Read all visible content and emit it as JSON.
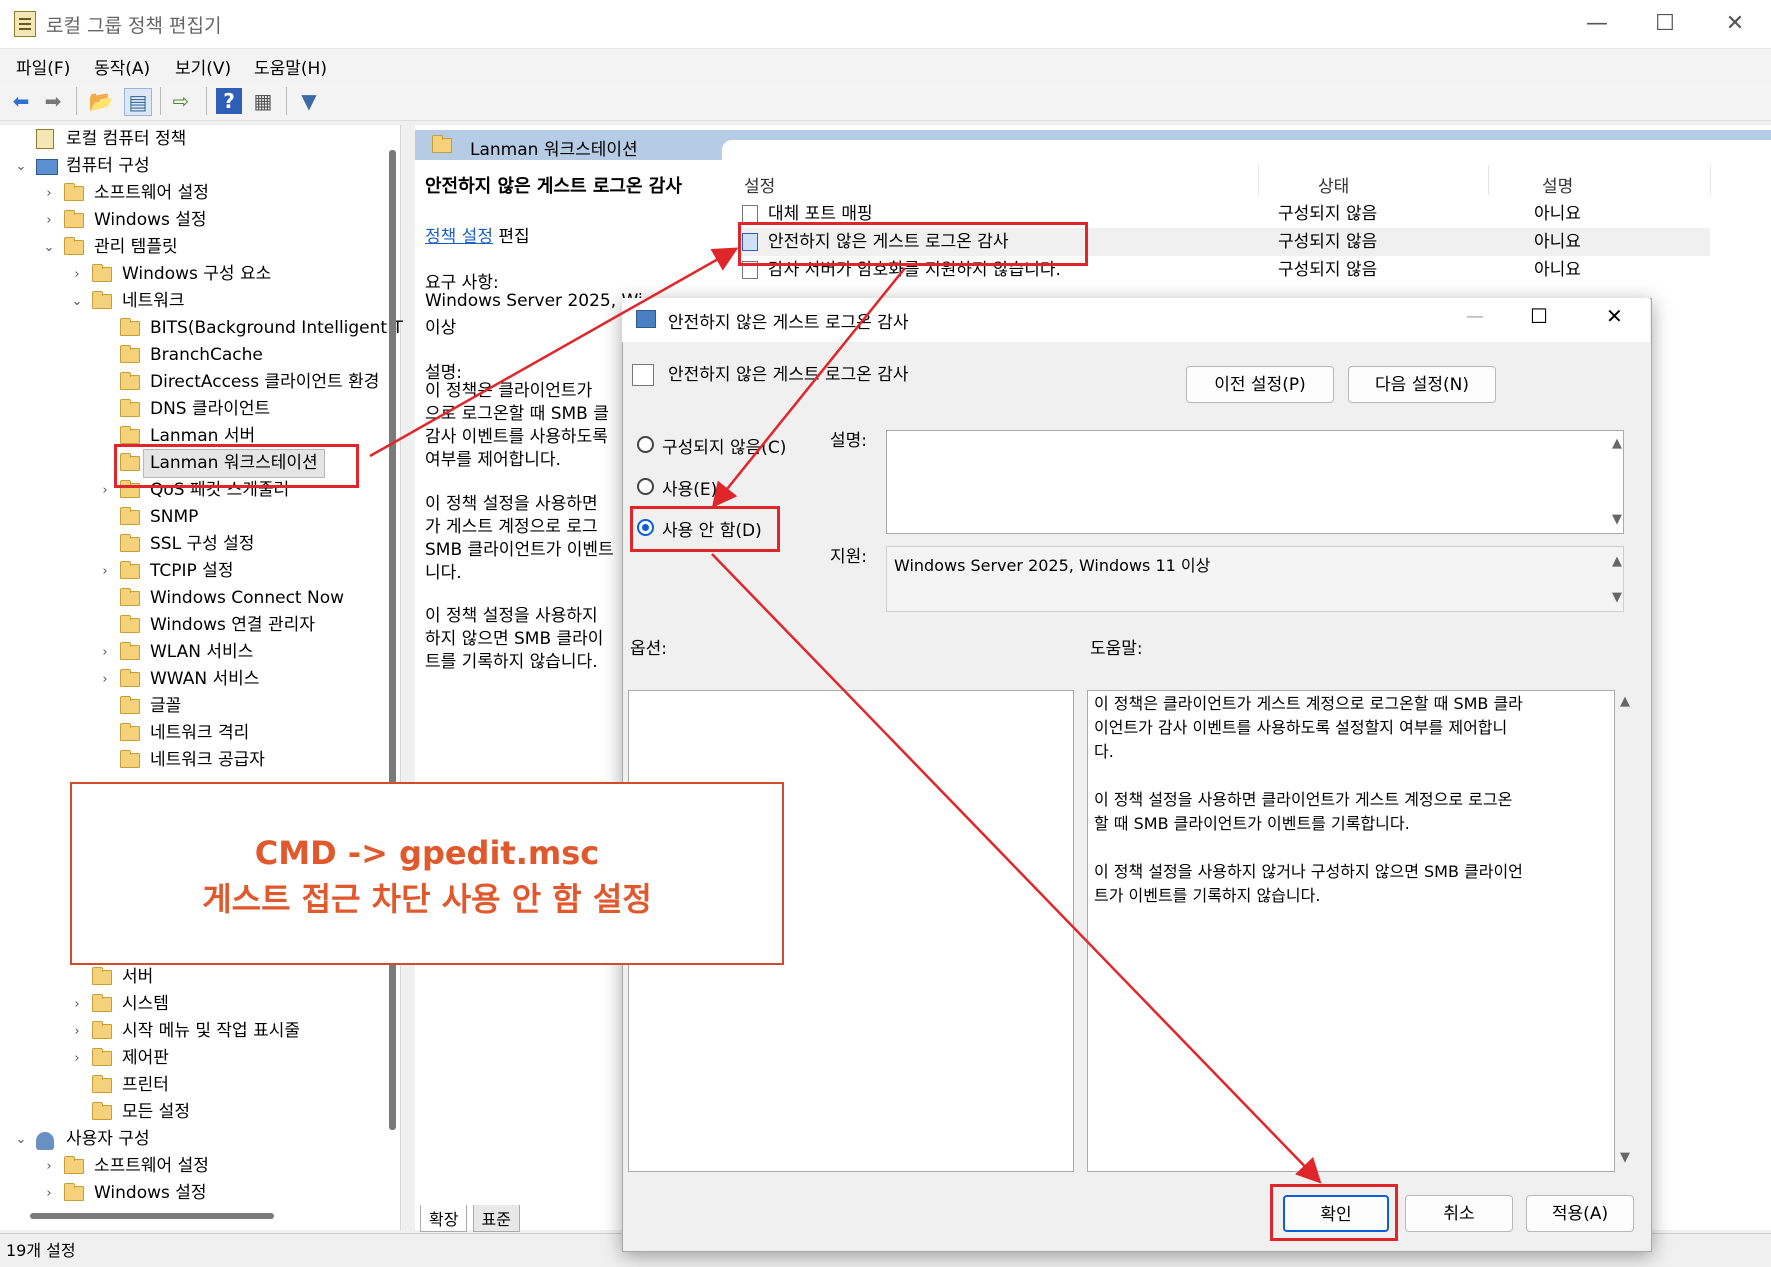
{
  "window": {
    "title": "로컬 그룹 정책 편집기",
    "minimize": "—",
    "maximize": "☐",
    "close": "✕"
  },
  "menu": [
    "파일(F)",
    "동작(A)",
    "보기(V)",
    "도움말(H)"
  ],
  "tree": [
    {
      "label": "로컬 컴퓨터 정책",
      "level": 0,
      "chev": "",
      "icon": "doc"
    },
    {
      "label": "컴퓨터 구성",
      "level": 0,
      "chev": "v",
      "icon": "computer"
    },
    {
      "label": "소프트웨어 설정",
      "level": 1,
      "chev": ">",
      "icon": "folder"
    },
    {
      "label": "Windows 설정",
      "level": 1,
      "chev": ">",
      "icon": "folder"
    },
    {
      "label": "관리 템플릿",
      "level": 1,
      "chev": "v",
      "icon": "folder"
    },
    {
      "label": "Windows 구성 요소",
      "level": 2,
      "chev": ">",
      "icon": "folder"
    },
    {
      "label": "네트워크",
      "level": 2,
      "chev": "v",
      "icon": "folder"
    },
    {
      "label": "BITS(Background Intelligent T",
      "level": 3,
      "chev": "",
      "icon": "folder"
    },
    {
      "label": "BranchCache",
      "level": 3,
      "chev": "",
      "icon": "folder"
    },
    {
      "label": "DirectAccess 클라이언트 환경",
      "level": 3,
      "chev": "",
      "icon": "folder"
    },
    {
      "label": "DNS 클라이언트",
      "level": 3,
      "chev": "",
      "icon": "folder"
    },
    {
      "label": "Lanman 서버",
      "level": 3,
      "chev": "",
      "icon": "folder"
    },
    {
      "label": "Lanman 워크스테이션",
      "level": 3,
      "chev": "",
      "icon": "folder",
      "selected": true
    },
    {
      "label": "QoS 패킷 스케줄러",
      "level": 3,
      "chev": ">",
      "icon": "folder"
    },
    {
      "label": "SNMP",
      "level": 3,
      "chev": "",
      "icon": "folder"
    },
    {
      "label": "SSL 구성 설정",
      "level": 3,
      "chev": "",
      "icon": "folder"
    },
    {
      "label": "TCPIP 설정",
      "level": 3,
      "chev": ">",
      "icon": "folder"
    },
    {
      "label": "Windows Connect Now",
      "level": 3,
      "chev": "",
      "icon": "folder"
    },
    {
      "label": "Windows 연결 관리자",
      "level": 3,
      "chev": "",
      "icon": "folder"
    },
    {
      "label": "WLAN 서비스",
      "level": 3,
      "chev": ">",
      "icon": "folder"
    },
    {
      "label": "WWAN 서비스",
      "level": 3,
      "chev": ">",
      "icon": "folder"
    },
    {
      "label": "글꼴",
      "level": 3,
      "chev": "",
      "icon": "folder"
    },
    {
      "label": "네트워크 격리",
      "level": 3,
      "chev": "",
      "icon": "folder"
    },
    {
      "label": "네트워크 공급자",
      "level": 3,
      "chev": "",
      "icon": "folder"
    }
  ],
  "tree_bottom": [
    {
      "label": "서버",
      "level": 2,
      "chev": "",
      "icon": "folder"
    },
    {
      "label": "시스템",
      "level": 2,
      "chev": ">",
      "icon": "folder"
    },
    {
      "label": "시작 메뉴 및 작업 표시줄",
      "level": 2,
      "chev": ">",
      "icon": "folder"
    },
    {
      "label": "제어판",
      "level": 2,
      "chev": ">",
      "icon": "folder"
    },
    {
      "label": "프린터",
      "level": 2,
      "chev": "",
      "icon": "folder"
    },
    {
      "label": "모든 설정",
      "level": 2,
      "chev": "",
      "icon": "folder"
    },
    {
      "label": "사용자 구성",
      "level": 0,
      "chev": "v",
      "icon": "user"
    },
    {
      "label": "소프트웨어 설정",
      "level": 1,
      "chev": ">",
      "icon": "folder"
    },
    {
      "label": "Windows 설정",
      "level": 1,
      "chev": ">",
      "icon": "folder"
    }
  ],
  "right": {
    "header": "Lanman 워크스테이션",
    "policy_title": "안전하지 않은 게스트 로그온 감사",
    "edit_link": "정책 설정",
    "edit_suffix": "편집",
    "req_label": "요구 사항:",
    "req_text": "Windows Server 2025, Wi",
    "req_text2": "이상",
    "desc_label": "설명:",
    "desc_lines": [
      "이 정책은 클라이언트가",
      "으로 로그온할 때 SMB 클",
      "감사 이벤트를 사용하도록",
      "여부를 제어합니다."
    ],
    "desc2_lines": [
      "이 정책 설정을 사용하면",
      "가 게스트 계정으로 로그",
      "SMB 클라이언트가 이벤트",
      "니다."
    ],
    "desc3_lines": [
      "이 정책 설정을 사용하지",
      "하지 않으면 SMB 클라이",
      "트를 기록하지 않습니다."
    ],
    "columns": [
      "설정",
      "상태",
      "설명"
    ],
    "rows": [
      {
        "name": "대체 포트 매핑",
        "state": "구성되지 않음",
        "comment": "아니요"
      },
      {
        "name": "안전하지 않은 게스트 로그온 감사",
        "state": "구성되지 않음",
        "comment": "아니요"
      },
      {
        "name": "감사 서버가 암호화를 지원하지 않습니다.",
        "state": "구성되지 않음",
        "comment": "아니요"
      }
    ],
    "tabs": [
      "확장",
      "표준"
    ]
  },
  "status": "19개 설정",
  "dialog": {
    "title": "안전하지 않은 게스트 로그온 감사",
    "heading": "안전하지 않은 게스트 로그온 감사",
    "prev_btn": "이전 설정(P)",
    "next_btn": "다음 설정(N)",
    "radio_nc": "구성되지 않음(C)",
    "radio_en": "사용(E)",
    "radio_dis": "사용 안 함(D)",
    "comment_label": "설명:",
    "support_label": "지원:",
    "support_text": "Windows Server 2025, Windows 11 이상",
    "options_label": "옵션:",
    "help_label": "도움말:",
    "help_text": "이 정책은 클라이언트가 게스트 계정으로 로그온할 때 SMB 클라\n이언트가 감사 이벤트를 사용하도록 설정할지 여부를 제어합니\n다.\n\n이 정책 설정을 사용하면 클라이언트가 게스트 계정으로 로그온\n할 때 SMB 클라이언트가 이벤트를 기록합니다.\n\n이 정책 설정을 사용하지 않거나 구성하지 않으면 SMB 클라이언\n트가 이벤트를 기록하지 않습니다.",
    "ok": "확인",
    "cancel": "취소",
    "apply": "적용(A)"
  },
  "annotation": {
    "line1": "CMD -> gpedit.msc",
    "line2": "게스트 접근 차단 사용 안 함 설정",
    "color": "#e0262a"
  }
}
